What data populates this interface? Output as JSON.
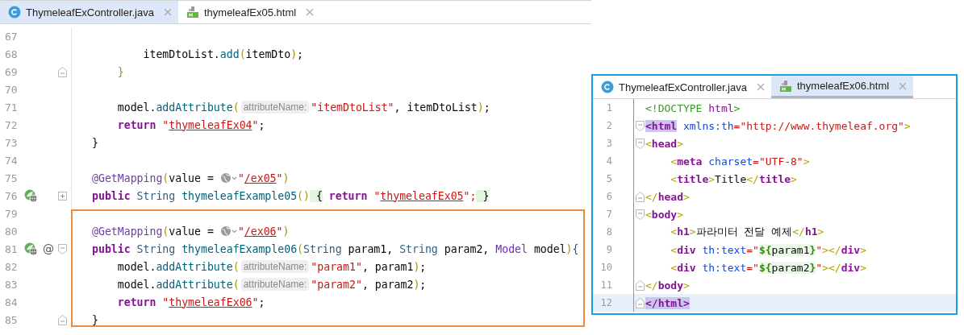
{
  "left_editor": {
    "tabs": [
      {
        "kind": "java",
        "label": "ThymeleafExController.java",
        "selected": true
      },
      {
        "kind": "html",
        "label": "thymeleafEx05.html",
        "selected": false
      }
    ],
    "lines": [
      {
        "n": "67"
      },
      {
        "n": "68",
        "tokens": [
          {
            "t": "        itemDtoList.",
            "kind": "plain"
          },
          {
            "t": "add",
            "kind": "method"
          },
          {
            "t": "(",
            "kind": "paren"
          },
          {
            "t": "itemDto",
            "kind": "plain"
          },
          {
            "t": ")",
            "kind": "paren"
          },
          {
            "t": ";",
            "kind": "plain"
          }
        ]
      },
      {
        "n": "69",
        "fold_end": true,
        "tokens": [
          {
            "t": "    }",
            "kind": "paren"
          }
        ]
      },
      {
        "n": "70"
      },
      {
        "n": "71",
        "tokens": [
          {
            "t": "    model.",
            "kind": "plain"
          },
          {
            "t": "addAttribute",
            "kind": "method"
          },
          {
            "t": "(",
            "kind": "paren"
          },
          {
            "t": "attributeName:",
            "kind": "hint"
          },
          {
            "t": "\"itemDtoList\"",
            "kind": "str"
          },
          {
            "t": ", itemDtoList",
            "kind": "plain"
          },
          {
            "t": ")",
            "kind": "paren"
          },
          {
            "t": ";",
            "kind": "plain"
          }
        ]
      },
      {
        "n": "72",
        "tokens": [
          {
            "t": "    return",
            "kind": "kw"
          },
          {
            "t": " \"",
            "kind": "str"
          },
          {
            "t": "thymeleafEx04",
            "kind": "link"
          },
          {
            "t": "\"",
            "kind": "str"
          },
          {
            "t": ";",
            "kind": "plain"
          }
        ]
      },
      {
        "n": "73",
        "tokens": [
          {
            "t": "}",
            "kind": "plain"
          }
        ]
      },
      {
        "n": "74"
      },
      {
        "n": "75",
        "tokens": [
          {
            "t": "@GetMapping",
            "kind": "ann"
          },
          {
            "t": "(",
            "kind": "paren"
          },
          {
            "t": "value =",
            "kind": "plain"
          },
          {
            "kind": "globe"
          },
          {
            "t": "\"",
            "kind": "str"
          },
          {
            "t": "/ex05",
            "kind": "link"
          },
          {
            "t": "\"",
            "kind": "str"
          },
          {
            "t": ")",
            "kind": "paren"
          }
        ]
      },
      {
        "n": "76",
        "run": true,
        "folded": true,
        "tokens": [
          {
            "t": "public",
            "kind": "kw"
          },
          {
            "t": " String",
            "kind": "type"
          },
          {
            "t": " thymeleafExample05",
            "kind": "method"
          },
          {
            "t": "()",
            "kind": "paren"
          },
          {
            "t": " {",
            "kind": "brace-hl"
          },
          {
            "t": " return",
            "kind": "kw"
          },
          {
            "t": " \"",
            "kind": "str"
          },
          {
            "t": "thymeleafEx05",
            "kind": "link"
          },
          {
            "t": "\";",
            "kind": "str"
          },
          {
            "t": " }",
            "kind": "brace-hl"
          }
        ]
      },
      {
        "n": "79"
      },
      {
        "n": "80",
        "boxed": true,
        "tokens": [
          {
            "t": "@GetMapping",
            "kind": "ann"
          },
          {
            "t": "(",
            "kind": "paren"
          },
          {
            "t": "value =",
            "kind": "plain"
          },
          {
            "kind": "globe"
          },
          {
            "t": "\"",
            "kind": "str"
          },
          {
            "t": "/ex06",
            "kind": "link"
          },
          {
            "t": "\"",
            "kind": "str"
          },
          {
            "t": ")",
            "kind": "paren"
          }
        ]
      },
      {
        "n": "81",
        "boxed": true,
        "run": true,
        "marker": "@",
        "fold_start": true,
        "tokens": [
          {
            "t": "public",
            "kind": "kw"
          },
          {
            "t": " String",
            "kind": "type"
          },
          {
            "t": " thymeleafExample06",
            "kind": "method"
          },
          {
            "t": "(",
            "kind": "paren"
          },
          {
            "t": "String",
            "kind": "type"
          },
          {
            "t": " param1, ",
            "kind": "plain"
          },
          {
            "t": "String",
            "kind": "type"
          },
          {
            "t": " param2, ",
            "kind": "plain"
          },
          {
            "t": "Model",
            "kind": "cls"
          },
          {
            "t": " model",
            "kind": "plain"
          },
          {
            "t": ")",
            "kind": "paren"
          },
          {
            "t": "{",
            "kind": "brace"
          }
        ]
      },
      {
        "n": "82",
        "boxed": true,
        "tokens": [
          {
            "t": "    model.",
            "kind": "plain"
          },
          {
            "t": "addAttribute",
            "kind": "method"
          },
          {
            "t": "(",
            "kind": "paren"
          },
          {
            "t": "attributeName:",
            "kind": "hint"
          },
          {
            "t": "\"param1\"",
            "kind": "str"
          },
          {
            "t": ", param1",
            "kind": "plain"
          },
          {
            "t": ")",
            "kind": "paren"
          },
          {
            "t": ";",
            "kind": "plain"
          }
        ]
      },
      {
        "n": "83",
        "boxed": true,
        "tokens": [
          {
            "t": "    model.",
            "kind": "plain"
          },
          {
            "t": "addAttribute",
            "kind": "method"
          },
          {
            "t": "(",
            "kind": "paren"
          },
          {
            "t": "attributeName:",
            "kind": "hint"
          },
          {
            "t": "\"param2\"",
            "kind": "str"
          },
          {
            "t": ", param2",
            "kind": "plain"
          },
          {
            "t": ")",
            "kind": "paren"
          },
          {
            "t": ";",
            "kind": "plain"
          }
        ]
      },
      {
        "n": "84",
        "boxed": true,
        "tokens": [
          {
            "t": "    return",
            "kind": "kw"
          },
          {
            "t": " \"",
            "kind": "str"
          },
          {
            "t": "thymeleafEx06",
            "kind": "link"
          },
          {
            "t": "\"",
            "kind": "str"
          },
          {
            "t": ";",
            "kind": "plain"
          }
        ]
      },
      {
        "n": "85",
        "boxed": true,
        "fold_end": true,
        "tokens": [
          {
            "t": "}",
            "kind": "plain"
          }
        ]
      }
    ]
  },
  "right_editor": {
    "tabs": [
      {
        "kind": "java",
        "label": "ThymeleafExController.java",
        "selected": false
      },
      {
        "kind": "html",
        "label": "thymeleafEx06.html",
        "selected": true
      }
    ],
    "lines": [
      {
        "n": "1",
        "current": false,
        "tokens": [
          {
            "t": "<!DOCTYPE",
            "kind": "doctype"
          },
          {
            "t": " html",
            "kind": "dtname"
          },
          {
            "t": ">",
            "kind": "doctype"
          }
        ]
      },
      {
        "n": "2",
        "current": false,
        "fold_start": true,
        "tokens": [
          {
            "t": "<html",
            "kind": "tag-hl"
          },
          {
            "t": " xmlns:th",
            "kind": "attr"
          },
          {
            "t": "=\"http://www.thymeleaf.org\"",
            "kind": "hstr"
          },
          {
            "t": ">",
            "kind": "hbr"
          }
        ]
      },
      {
        "n": "3",
        "current": false,
        "fold_start": true,
        "tokens": [
          {
            "t": "<",
            "kind": "hbr"
          },
          {
            "t": "head",
            "kind": "tag"
          },
          {
            "t": ">",
            "kind": "hbr"
          }
        ]
      },
      {
        "n": "4",
        "current": false,
        "tokens": [
          {
            "t": "    <",
            "kind": "hbr"
          },
          {
            "t": "meta",
            "kind": "tag"
          },
          {
            "t": " charset",
            "kind": "attr"
          },
          {
            "t": "=\"UTF-8\"",
            "kind": "hstr"
          },
          {
            "t": ">",
            "kind": "hbr"
          }
        ]
      },
      {
        "n": "5",
        "current": false,
        "tokens": [
          {
            "t": "    <",
            "kind": "hbr"
          },
          {
            "t": "title",
            "kind": "tag"
          },
          {
            "t": ">",
            "kind": "hbr"
          },
          {
            "t": "Title",
            "kind": "plain"
          },
          {
            "t": "</",
            "kind": "hbr"
          },
          {
            "t": "title",
            "kind": "tag"
          },
          {
            "t": ">",
            "kind": "hbr"
          }
        ]
      },
      {
        "n": "6",
        "current": false,
        "fold_end": true,
        "tokens": [
          {
            "t": "</",
            "kind": "hbr"
          },
          {
            "t": "head",
            "kind": "tag"
          },
          {
            "t": ">",
            "kind": "hbr"
          }
        ]
      },
      {
        "n": "7",
        "current": false,
        "fold_start": true,
        "tokens": [
          {
            "t": "<",
            "kind": "hbr"
          },
          {
            "t": "body",
            "kind": "tag"
          },
          {
            "t": ">",
            "kind": "hbr"
          }
        ]
      },
      {
        "n": "8",
        "current": false,
        "tokens": [
          {
            "t": "    <",
            "kind": "hbr"
          },
          {
            "t": "h1",
            "kind": "tag"
          },
          {
            "t": ">",
            "kind": "hbr"
          },
          {
            "t": "파라미터 전달 예제",
            "kind": "plain"
          },
          {
            "t": "</",
            "kind": "hbr"
          },
          {
            "t": "h1",
            "kind": "tag"
          },
          {
            "t": ">",
            "kind": "hbr"
          }
        ]
      },
      {
        "n": "9",
        "current": false,
        "tokens": [
          {
            "t": "    <",
            "kind": "hbr"
          },
          {
            "t": "div",
            "kind": "tag"
          },
          {
            "t": " th:text",
            "kind": "attr"
          },
          {
            "t": "=\"",
            "kind": "hstr"
          },
          {
            "t": "${",
            "kind": "expr-br"
          },
          {
            "t": "param1",
            "kind": "expr"
          },
          {
            "t": "}",
            "kind": "expr-br"
          },
          {
            "t": "\"",
            "kind": "hstr"
          },
          {
            "t": "></",
            "kind": "hbr"
          },
          {
            "t": "div",
            "kind": "tag"
          },
          {
            "t": ">",
            "kind": "hbr"
          }
        ]
      },
      {
        "n": "10",
        "current": false,
        "tokens": [
          {
            "t": "    <",
            "kind": "hbr"
          },
          {
            "t": "div",
            "kind": "tag"
          },
          {
            "t": " th:text",
            "kind": "attr"
          },
          {
            "t": "=\"",
            "kind": "hstr"
          },
          {
            "t": "${",
            "kind": "expr-br"
          },
          {
            "t": "param2",
            "kind": "expr"
          },
          {
            "t": "}",
            "kind": "expr-br"
          },
          {
            "t": "\"",
            "kind": "hstr"
          },
          {
            "t": "></",
            "kind": "hbr"
          },
          {
            "t": "div",
            "kind": "tag"
          },
          {
            "t": ">",
            "kind": "hbr"
          }
        ]
      },
      {
        "n": "11",
        "current": false,
        "fold_end": true,
        "tokens": [
          {
            "t": "</",
            "kind": "hbr"
          },
          {
            "t": "body",
            "kind": "tag"
          },
          {
            "t": ">",
            "kind": "hbr"
          }
        ]
      },
      {
        "n": "12",
        "current": true,
        "fold_end": true,
        "tokens": [
          {
            "t": "</html>",
            "kind": "tag-hl"
          }
        ]
      }
    ]
  }
}
